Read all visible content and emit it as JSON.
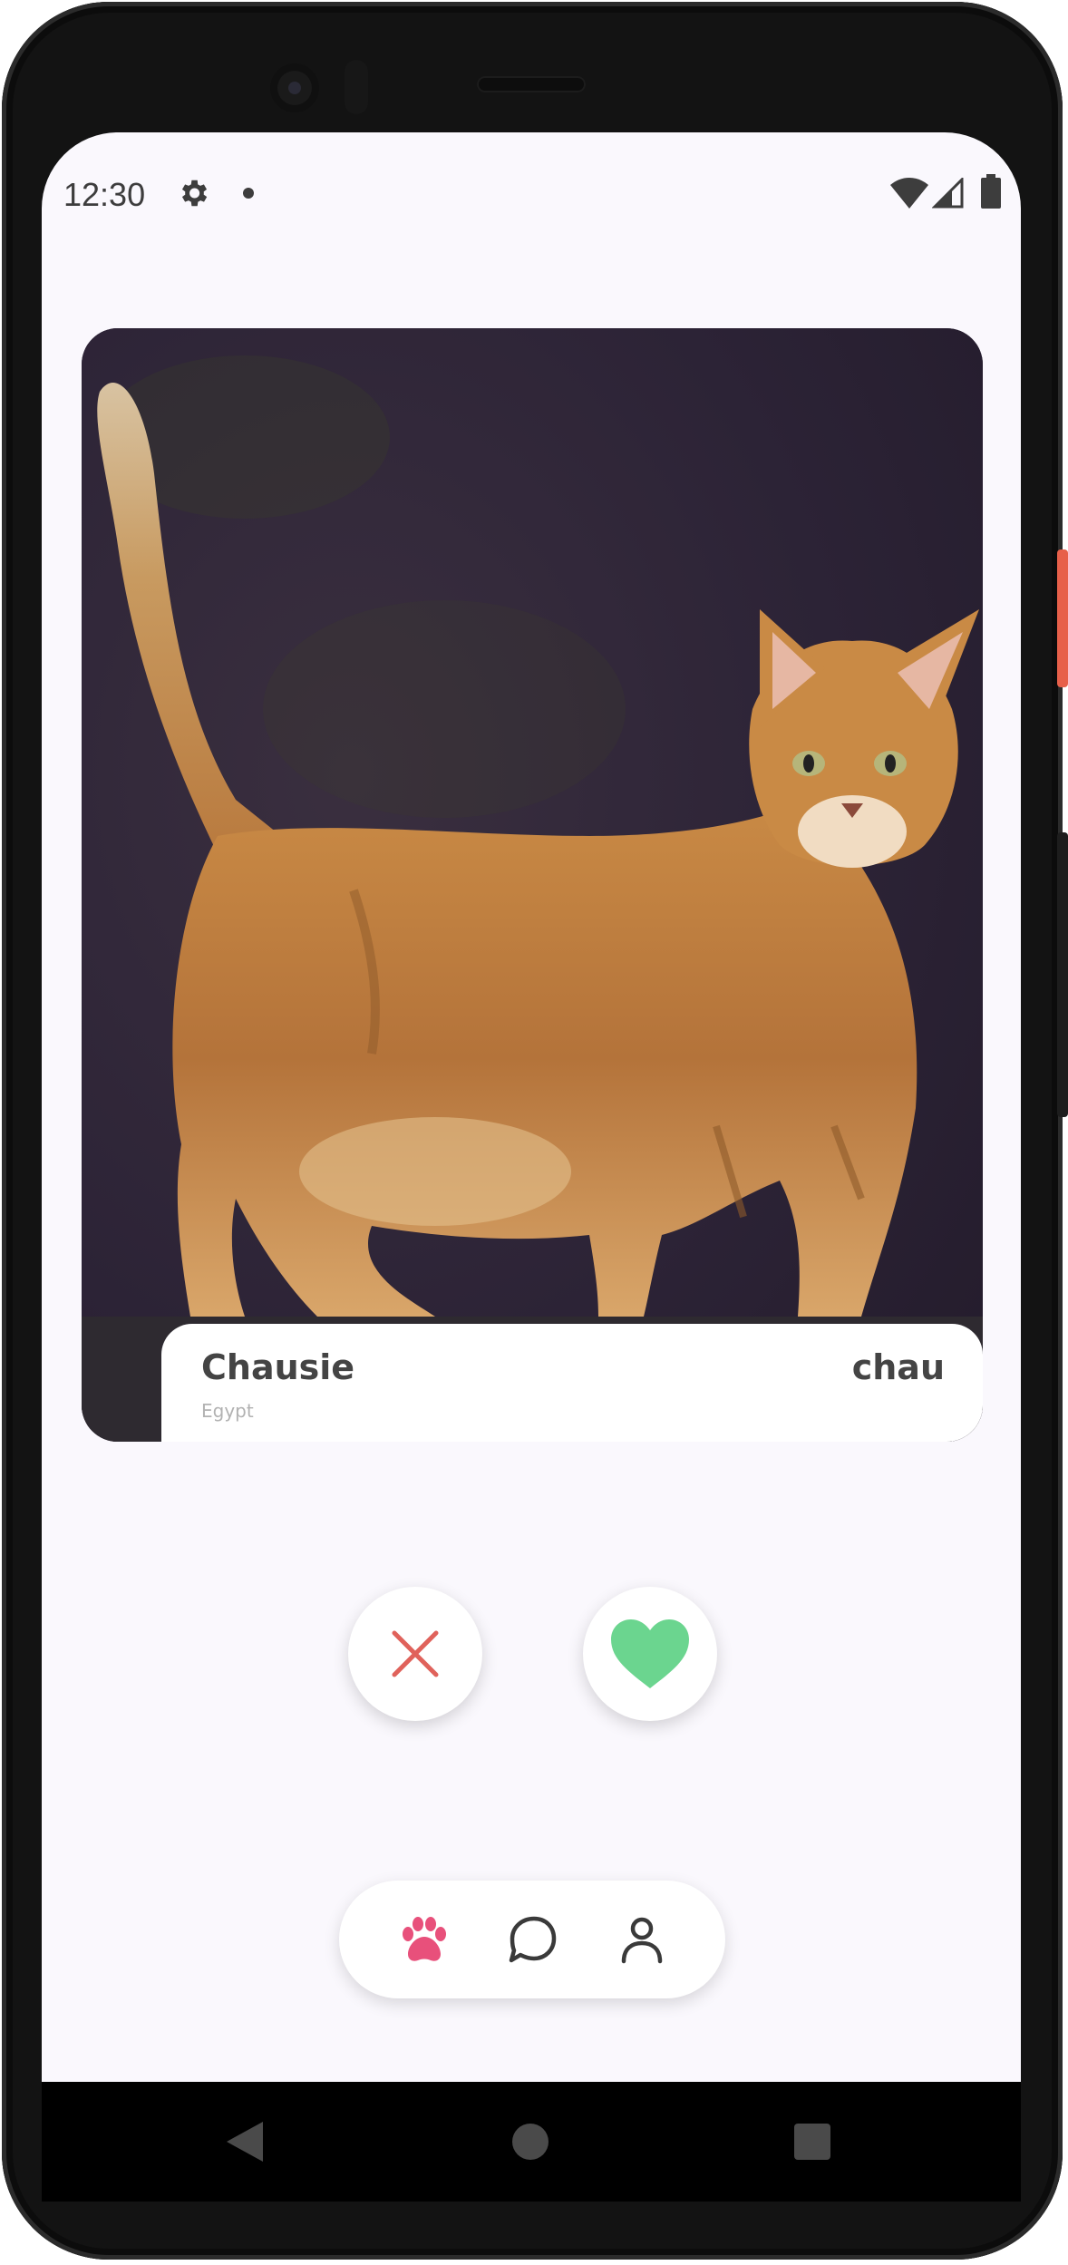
{
  "status_bar": {
    "time": "12:30",
    "icons": [
      "gear-icon",
      "notification-dot-icon",
      "wifi-icon",
      "cell-signal-icon",
      "battery-icon"
    ]
  },
  "card": {
    "photo": "cat-photo",
    "breed_name": "Chausie",
    "origin": "Egypt",
    "breed_id": "chau"
  },
  "actions": {
    "dislike_icon": "close-icon",
    "like_icon": "heart-icon",
    "dislike_color": "#e0625b",
    "like_color": "#6bd58f"
  },
  "bottom_nav": {
    "items": [
      {
        "icon": "paw-icon",
        "active": true
      },
      {
        "icon": "chat-icon",
        "active": false
      },
      {
        "icon": "profile-icon",
        "active": false
      }
    ],
    "active_color": "#e8507b",
    "inactive_color": "#3a3a3a"
  },
  "system_nav": [
    "back-icon",
    "home-icon",
    "recents-icon"
  ]
}
